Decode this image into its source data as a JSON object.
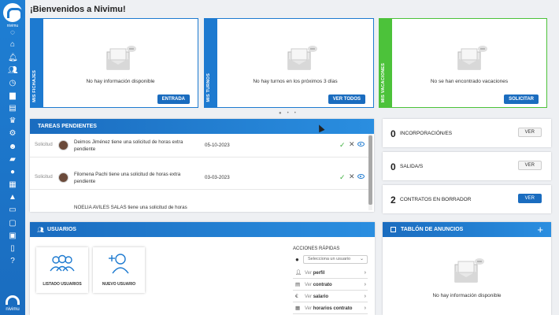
{
  "brand": {
    "logo_text": "nivimu",
    "bottom_text": "nivimu"
  },
  "header": {
    "title": "¡Bienvenidos a Nivimu!"
  },
  "cards": [
    {
      "label": "MIS FICHAJES",
      "message": "No hay información disponible",
      "button": "ENTRADA",
      "color": "#1d7ad0"
    },
    {
      "label": "MIS TURNOS",
      "message": "No hay turnos en los próximos 3 días",
      "button": "VER TODOS",
      "color": "#1d7ad0"
    },
    {
      "label": "MIS VACACIONES",
      "message": "No se han encontrado vacaciones",
      "button": "SOLICITAR",
      "color": "#4cc23a"
    }
  ],
  "tareas": {
    "title": "TAREAS PENDIENTES",
    "rows": [
      {
        "type": "Solicitud",
        "text": "Deimos Jiménez tiene una solicitud de horas extra pendiente",
        "date": "05-10-2023"
      },
      {
        "type": "Solicitud",
        "text": "Filomena Pachi tiene una solicitud de horas extra pendiente",
        "date": "03-03-2023"
      },
      {
        "type": "",
        "text": "NOELIA AVILES SALAS tiene una solicitud de horas extra",
        "date": ""
      }
    ]
  },
  "stats": [
    {
      "value": "0",
      "label": "INCORPORACIÓN/ES",
      "button": "VER"
    },
    {
      "value": "0",
      "label": "SALIDA/S",
      "button": "VER"
    },
    {
      "value": "2",
      "label": "CONTRATOS EN BORRADOR",
      "button": "VER"
    }
  ],
  "usuarios": {
    "title": "USUARIOS",
    "tiles": [
      {
        "label": "LISTADO USUARIOS"
      },
      {
        "label": "NUEVO USUARIO"
      }
    ],
    "quick": {
      "title": "ACCIONES RÁPIDAS",
      "select_placeholder": "Selecciona un usuario",
      "items": [
        {
          "pre": "Ver ",
          "bold": "perfil"
        },
        {
          "pre": "Ver ",
          "bold": "contrato"
        },
        {
          "pre": "Ver ",
          "bold": "salario"
        },
        {
          "pre": "Ver ",
          "bold": "horarios contrato"
        }
      ]
    }
  },
  "tablon": {
    "title": "TABLÓN DE ANUNCIOS",
    "message": "No hay información disponible"
  },
  "colors": {
    "primary": "#1d7ad0",
    "success": "#4cc23a"
  }
}
